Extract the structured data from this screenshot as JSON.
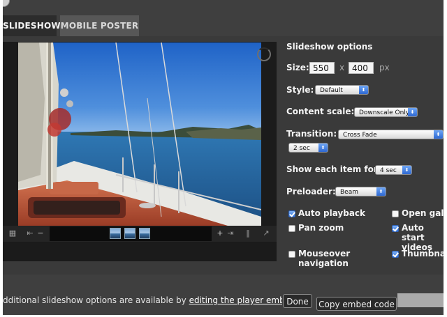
{
  "tabs": {
    "slideshow": "SLIDESHOW",
    "mobile_poster": "MOBILE POSTER"
  },
  "options": {
    "title": "Slideshow options",
    "size": {
      "label": "Size:",
      "width": "550",
      "times": "x",
      "height": "400",
      "unit": "px"
    },
    "style": {
      "label": "Style:",
      "value": "Default"
    },
    "content_scale": {
      "label": "Content scale:",
      "value": "Downscale Only"
    },
    "transition": {
      "label": "Transition:",
      "value": "Cross Fade",
      "duration": "2 sec"
    },
    "show_each": {
      "label": "Show each item for:",
      "value": "4 sec"
    },
    "preloader": {
      "label": "Preloader:",
      "value": "Beam"
    },
    "checkboxes": [
      {
        "label": "Auto playback",
        "checked": true
      },
      {
        "label": "Open galler",
        "checked": false
      },
      {
        "label": "Pan zoom",
        "checked": false
      },
      {
        "label": "Auto start videos",
        "checked": true
      },
      {
        "label": "Mouseover navigation",
        "checked": false
      },
      {
        "label": "Thumbnail",
        "checked": true
      }
    ]
  },
  "footer": {
    "text_prefix": "dditional slideshow options are available by ",
    "link": "editing the player embed",
    "done": "Done",
    "copy": "Copy embed code"
  },
  "player": {
    "icons": [
      "grid-icon",
      "previous-icon",
      "zoom-out-icon",
      "zoom-in-icon",
      "next-icon",
      "pause-icon",
      "popout-icon"
    ]
  }
}
